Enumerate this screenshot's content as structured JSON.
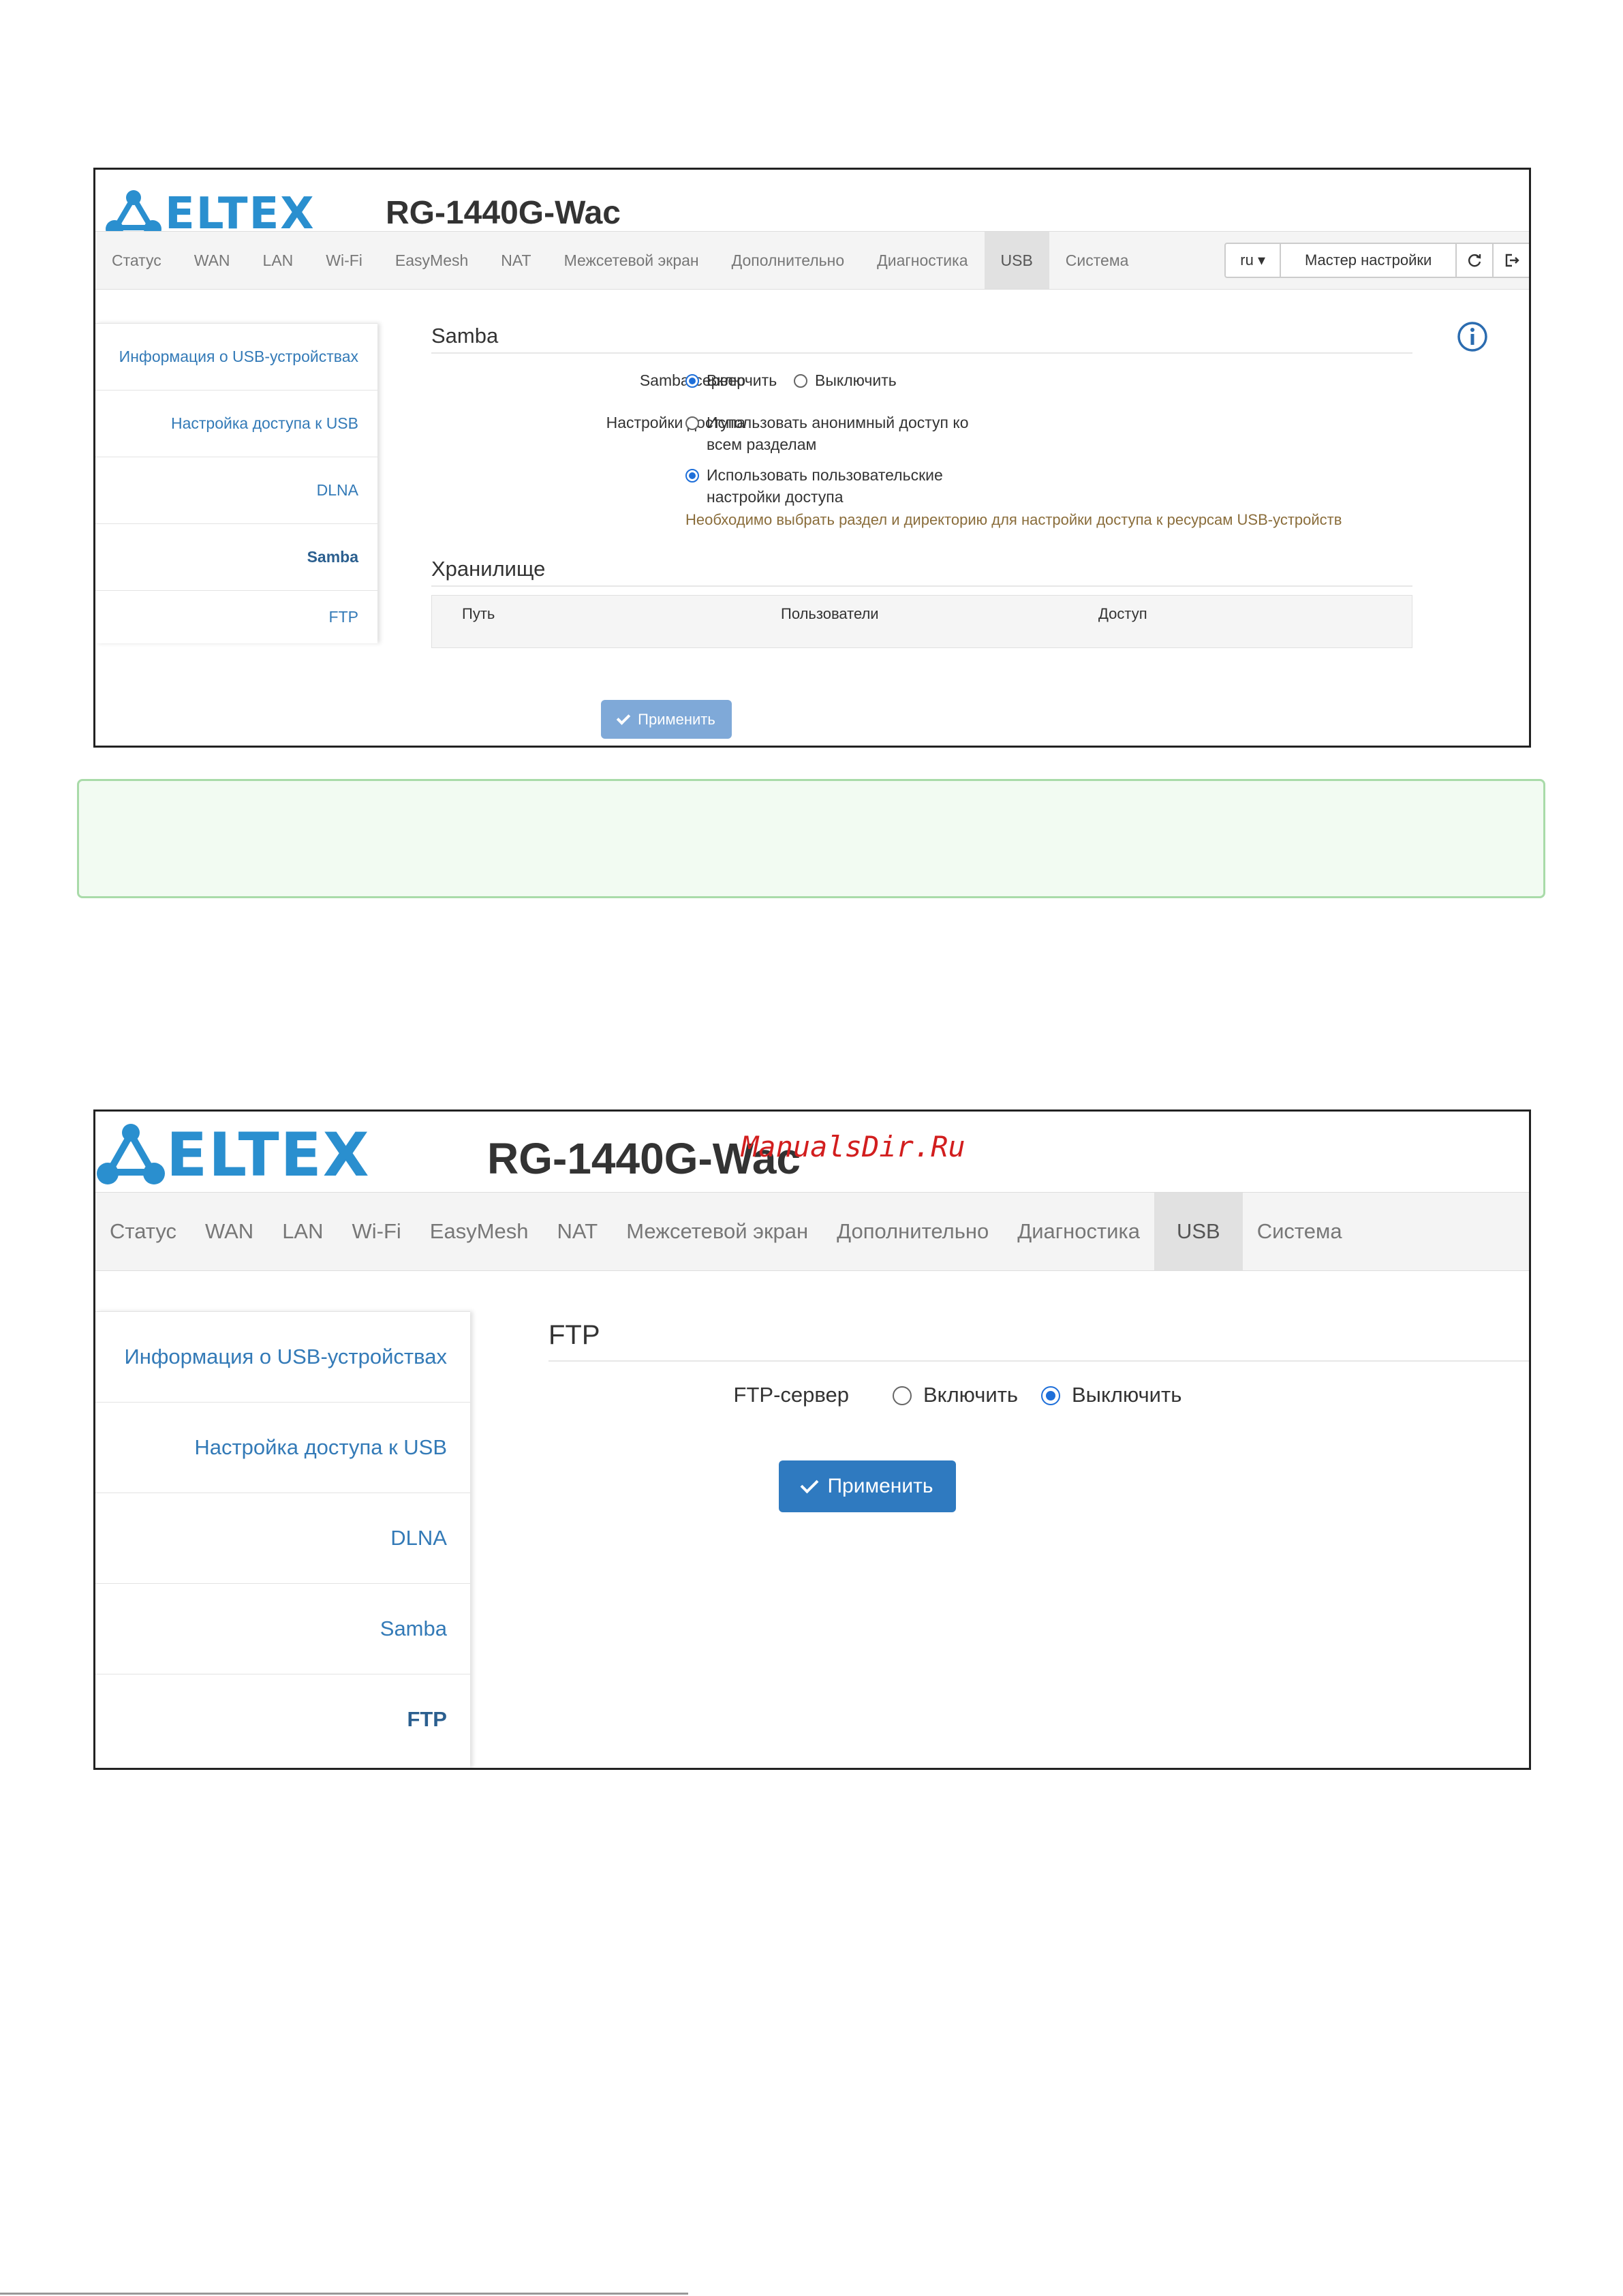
{
  "brand": {
    "logo": "ELTEX",
    "model": "RG-1440G-Wac"
  },
  "nav": [
    "Статус",
    "WAN",
    "LAN",
    "Wi-Fi",
    "EasyMesh",
    "NAT",
    "Межсетевой экран",
    "Дополнительно",
    "Диагностика",
    "USB",
    "Система"
  ],
  "nav_active": "USB",
  "toolbar": {
    "lang": "ru ▾",
    "wizard": "Мастер настройки",
    "refresh_icon": "refresh-icon",
    "logout_icon": "logout-icon"
  },
  "sidebar": [
    "Информация о USB-устройствах",
    "Настройка доступа к USB",
    "DLNA",
    "Samba",
    "FTP"
  ],
  "samba": {
    "title": "Samba",
    "server_label": "Samba-сервер",
    "enable": "Включить",
    "disable": "Выключить",
    "access_label": "Настройки доступа",
    "opt_anon_1": "Использовать анонимный доступ ко",
    "opt_anon_2": "всем разделам",
    "opt_user_1": "Использовать пользовательские",
    "opt_user_2": "настройки доступа",
    "note": "Необходимо выбрать раздел и директорию для настройки доступа к ресурсам USB-устройств",
    "storage_title": "Хранилище",
    "columns": [
      "Путь",
      "Пользователи",
      "Доступ"
    ],
    "apply": "Применить",
    "server_state": "on",
    "access_state": "user"
  },
  "ftp": {
    "title": "FTP",
    "server_label": "FTP-сервер",
    "enable": "Включить",
    "disable": "Выключить",
    "apply": "Применить",
    "server_state": "off"
  },
  "watermark": "ManualsDir.Ru",
  "colors": {
    "accent": "#337ab7",
    "button": "#2f7ac0",
    "button_disabled": "#7fa9d8",
    "note": "#8a6d3b",
    "logo": "#2a8fcf"
  }
}
